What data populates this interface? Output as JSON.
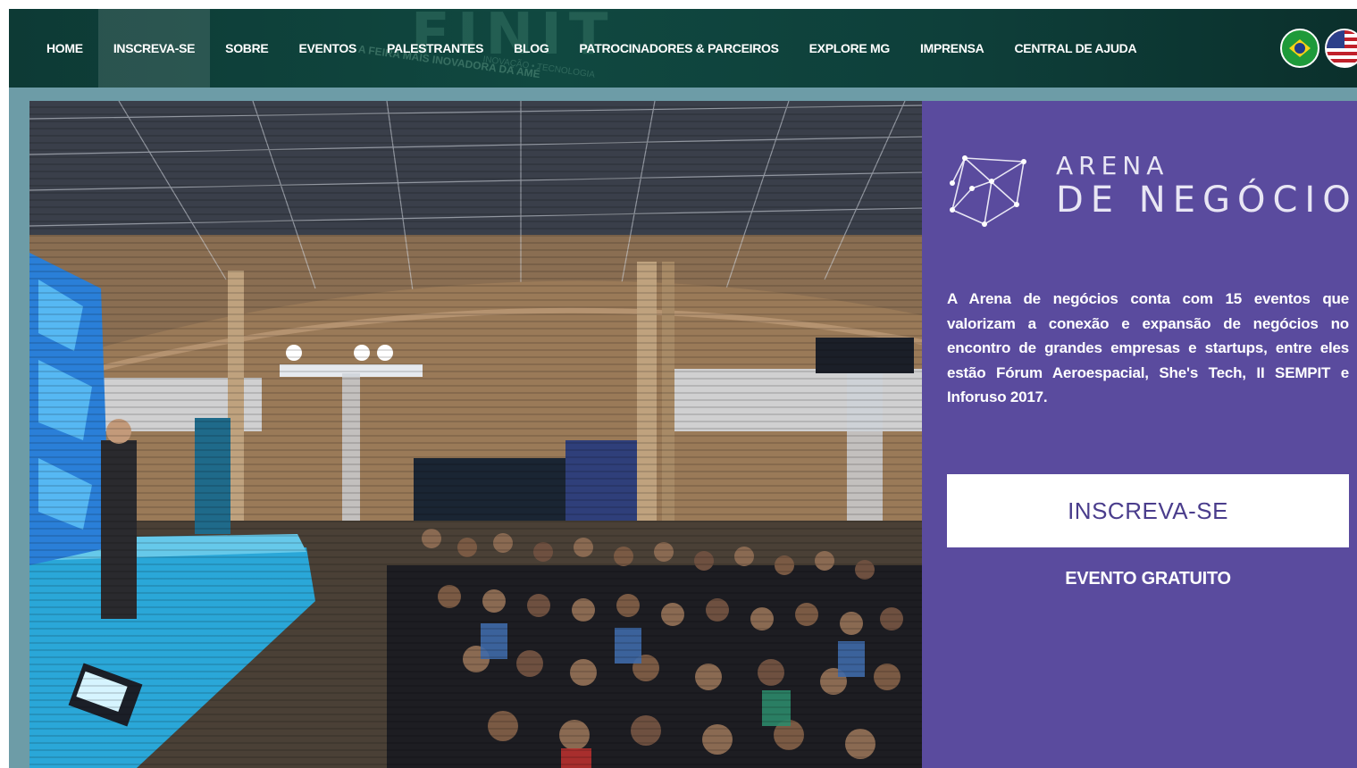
{
  "nav": {
    "items": [
      {
        "label": "HOME",
        "active": false
      },
      {
        "label": "INSCREVA-SE",
        "active": true
      },
      {
        "label": "SOBRE",
        "active": false
      },
      {
        "label": "EVENTOS",
        "active": false
      },
      {
        "label": "PALESTRANTES",
        "active": false
      },
      {
        "label": "BLOG",
        "active": false
      },
      {
        "label": "PATROCINADORES & PARCEIROS",
        "active": false
      },
      {
        "label": "EXPLORE MG",
        "active": false
      },
      {
        "label": "IMPRENSA",
        "active": false
      },
      {
        "label": "CENTRAL DE AJUDA",
        "active": false
      }
    ],
    "background_text": {
      "big": "FINIT",
      "tagline": "A FEIRA MAIS INOVADORA DA AMÉ",
      "small": "INOVAÇÃO • TECNOLOGIA"
    },
    "languages": [
      {
        "icon": "brazil-flag-icon"
      },
      {
        "icon": "usa-flag-icon"
      }
    ]
  },
  "hero": {
    "image_icon": "event-photo"
  },
  "panel": {
    "logo_line1": "ARENA",
    "logo_line2": "DE NEGÓCIOS",
    "description": "A Arena de negócios conta com 15 eventos que valorizam a conexão e expansão de negócios no encontro de grandes empresas e startups, entre eles estão Fórum Aeroespacial, She's Tech, II SEMPIT e Inforuso 2017.",
    "cta_label": "INSCREVA-SE",
    "note": "EVENTO GRATUITO"
  },
  "colors": {
    "nav_bg": "#0e3f3a",
    "band": "#6d9ca7",
    "panel_bg": "#5a4b9e",
    "cta_text": "#4a3d8c"
  }
}
